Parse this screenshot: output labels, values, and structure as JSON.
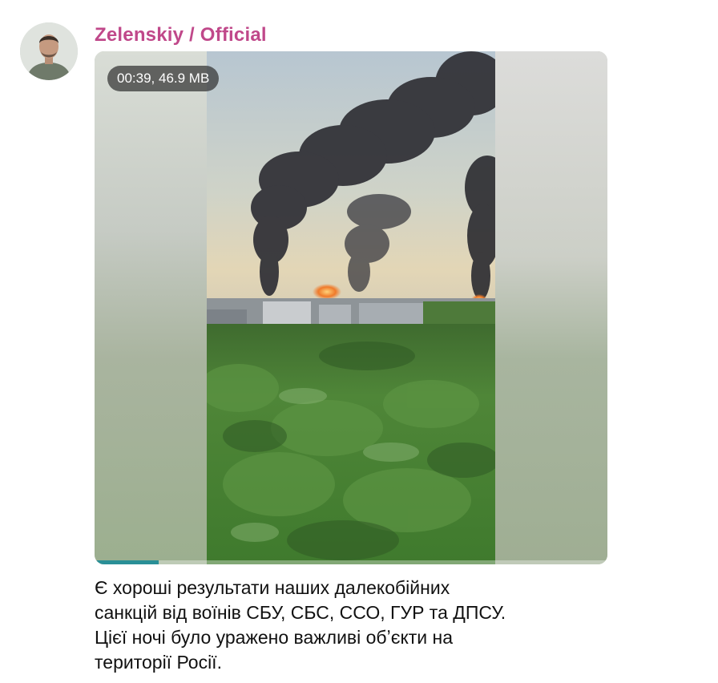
{
  "message": {
    "author": "Zelenskiy / Official",
    "media": {
      "duration_size": "00:39, 46.9 MB",
      "playback_progress": 0.125,
      "progress_color": "#2a8f97"
    },
    "caption_lines": [
      "Є хороші результати наших далекобійних",
      "санкцій від воїнів СБУ, СБС, ССО, ГУР та ДПСУ.",
      "Цієї ночі було уражено важливі обʼєкти на",
      "території Росії."
    ]
  },
  "colors": {
    "author_name": "#c0488a",
    "caption_text": "#111111"
  },
  "icons": {
    "avatar": "channel-avatar-icon"
  }
}
